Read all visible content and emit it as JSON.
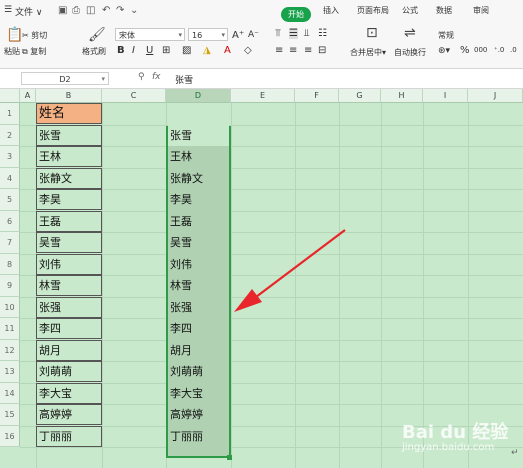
{
  "menu": {
    "file_label": "文件",
    "file_chevron": "∨",
    "tabs": [
      "开始",
      "插入",
      "页面布局",
      "公式",
      "数据",
      "审阅"
    ],
    "active_tab_index": 0
  },
  "toolbar": {
    "paste_label": "粘贴",
    "cut_label": "剪切",
    "copy_label": "复制",
    "format_painter_label": "格式刷",
    "font_name": "宋体",
    "font_size": "16",
    "grow_font": "A⁺",
    "shrink_font": "A⁻",
    "bold": "B",
    "italic": "I",
    "underline": "U",
    "merge_label": "合并居中",
    "wrap_label": "自动换行",
    "number_format": "常规",
    "percent": "%",
    "thousands": "000"
  },
  "formula_bar": {
    "cell_ref": "D2",
    "fx_label": "fx",
    "value": "张雪"
  },
  "sheet": {
    "columns": [
      "A",
      "B",
      "C",
      "D",
      "E",
      "F",
      "G",
      "H",
      "I",
      "J"
    ],
    "selected_column": "D",
    "rows": [
      "1",
      "2",
      "3",
      "4",
      "5",
      "6",
      "7",
      "8",
      "9",
      "10",
      "11",
      "12",
      "13",
      "14",
      "15",
      "16"
    ],
    "header_cell": "姓名",
    "names_b": [
      "张雪",
      "王林",
      "张静文",
      "李昊",
      "王磊",
      "吴雪",
      "刘伟",
      "林雪",
      "张强",
      "李四",
      "胡月",
      "刘萌萌",
      "李大宝",
      "高婷婷",
      "丁丽丽"
    ],
    "names_d": [
      "张雪",
      "王林",
      "张静文",
      "李昊",
      "王磊",
      "吴雪",
      "刘伟",
      "林雪",
      "张强",
      "李四",
      "胡月",
      "刘萌萌",
      "李大宝",
      "高婷婷",
      "丁丽丽"
    ]
  },
  "annotation": {
    "arrow_color": "#e8262b"
  },
  "watermark": {
    "text": "Bai du 经验",
    "sub": "jingyan.baidu.com"
  }
}
